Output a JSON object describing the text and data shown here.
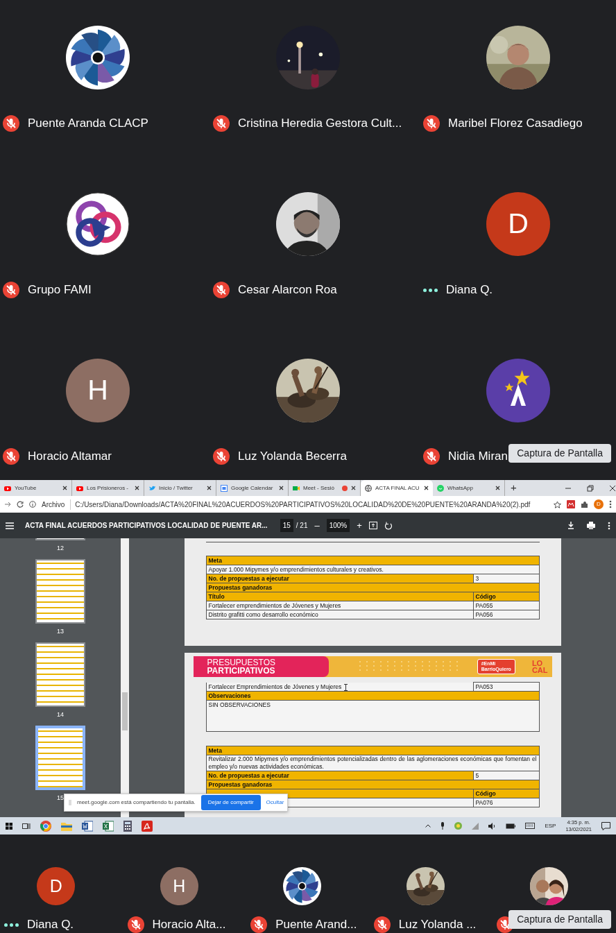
{
  "participants": [
    {
      "name": "Puente Aranda CLACP",
      "muted": true,
      "avatar": {
        "kind": "pinwheel"
      }
    },
    {
      "name": "Cristina Heredia Gestora Cult...",
      "muted": true
    },
    {
      "name": "Maribel Florez Casadiego",
      "muted": true
    },
    {
      "name": "Grupo FAMI",
      "muted": true,
      "avatar": {
        "kind": "rings"
      }
    },
    {
      "name": "Cesar Alarcon Roa",
      "muted": true
    },
    {
      "name": "Diana Q.",
      "muted": false,
      "avatar": {
        "kind": "initial",
        "initial": "D",
        "color": "#c5391a"
      }
    },
    {
      "name": "Horacio Altamar",
      "muted": true,
      "avatar": {
        "kind": "initial",
        "initial": "H",
        "color": "#8d6e63"
      }
    },
    {
      "name": "Luz Yolanda Becerra",
      "muted": true
    },
    {
      "name": "Nidia Miran",
      "muted": true,
      "avatar": {
        "kind": "star"
      }
    }
  ],
  "tooltip_top": "Captura de Pantalla",
  "browser": {
    "tabs": [
      {
        "title": "YouTube",
        "selected": false,
        "recording": false
      },
      {
        "title": "Los Prisioneros -",
        "selected": false,
        "recording": false
      },
      {
        "title": "Inicio / Twitter",
        "selected": false,
        "recording": false
      },
      {
        "title": "Google Calendar",
        "selected": false,
        "recording": false
      },
      {
        "title": "Meet - Sesió",
        "selected": false,
        "recording": true
      },
      {
        "title": "ACTA FINAL ACU",
        "selected": true,
        "recording": false
      },
      {
        "title": "WhatsApp",
        "selected": false,
        "recording": false
      }
    ],
    "new_tab": "+",
    "address_prefix": "Archivo",
    "url": "C:/Users/Diana/Downloads/ACTA%20FINAL%20ACUERDOS%20PARTICIPATIVOS%20LOCALIDAD%20DE%20PUENTE%20ARANDA%20(2).pdf",
    "profile_initial": "D"
  },
  "pdf": {
    "title": "ACTA FINAL ACUERDOS PARTICIPATIVOS LOCALIDAD DE PUENTE AR...",
    "page": "15",
    "page_total": "/ 21",
    "zoom_out": "–",
    "zoom": "100%",
    "zoom_in": "+",
    "thumbnails": [
      {
        "label": "12",
        "selected": false
      },
      {
        "label": "13",
        "selected": false
      },
      {
        "label": "14",
        "selected": false
      },
      {
        "label": "15",
        "selected": true
      }
    ],
    "page_a": [
      {
        "kind": "head",
        "text": "Meta"
      },
      {
        "kind": "text",
        "text": "Apoyar 1.000 Mipymes y/o emprendimientos culturales y creativos."
      },
      {
        "kind": "count",
        "label": "No. de propuestas a ejecutar",
        "value": "3"
      },
      {
        "kind": "head",
        "text": "Propuestas ganadoras"
      },
      {
        "kind": "columns",
        "title": "Título",
        "code": "Código"
      },
      {
        "kind": "item",
        "title": "Fortalecer emprendimientos de Jóvenes y Mujeres",
        "code": "PA055"
      },
      {
        "kind": "item",
        "title": "Distrito grafitti como desarrollo económico",
        "code": "PA056"
      }
    ],
    "banner": {
      "title_lines": [
        "PRESUPUESTOS",
        "PARTICIPATIVOS"
      ],
      "badge_lines": [
        "#EnMi",
        "BarrioQuiero"
      ],
      "logo_lines": [
        "LO",
        "CAL"
      ]
    },
    "page_b_top": [
      {
        "kind": "item",
        "title": "Fortalecer Emprendimientos de Jóvenes y Mujeres",
        "code": "PA053"
      },
      {
        "kind": "head",
        "text": "Observaciones"
      },
      {
        "kind": "note",
        "text": "SIN OBSERVACIONES"
      }
    ],
    "page_b": [
      {
        "kind": "head",
        "text": "Meta"
      },
      {
        "kind": "text",
        "text": "Revitalizar 2.000 Mipymes y/o emprendimientos potencializadas dentro de las aglomeraciones económicas que fomentan el empleo y/o nuevas actividades económicas."
      },
      {
        "kind": "count",
        "label": "No. de propuestas a ejecutar",
        "value": "5"
      },
      {
        "kind": "head",
        "text": "Propuestas ganadoras"
      },
      {
        "kind": "columns",
        "code": "Código"
      },
      {
        "kind": "item",
        "code": "PA076"
      }
    ],
    "share_bar": {
      "message": "meet.google.com está compartiendo tu pantalla.",
      "stop": "Dejar de compartir",
      "hide": "Ocultar"
    }
  },
  "taskbar": {
    "language": "ESP",
    "time": "4:35 p. m.",
    "date": "13/02/2021"
  },
  "strip": [
    {
      "name": "Diana Q.",
      "muted": false,
      "avatar": {
        "kind": "initial",
        "initial": "D",
        "color": "#c5391a"
      }
    },
    {
      "name": "Horacio Alta...",
      "muted": true,
      "avatar": {
        "kind": "initial",
        "initial": "H",
        "color": "#8d6e63"
      }
    },
    {
      "name": "Puente Arand...",
      "muted": true,
      "avatar": {
        "kind": "pinwheel"
      }
    },
    {
      "name": "Luz Yolanda ...",
      "muted": true
    },
    {
      "muted": true
    }
  ],
  "tooltip_bottom": "Captura de Pantalla"
}
